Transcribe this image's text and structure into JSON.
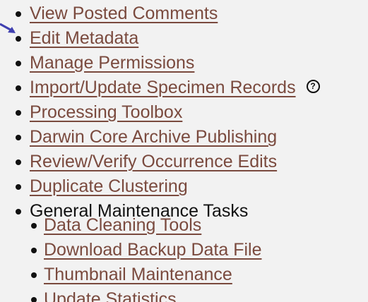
{
  "menu": {
    "items": [
      {
        "label": "View Posted Comments"
      },
      {
        "label": "Edit Metadata"
      },
      {
        "label": "Manage Permissions"
      },
      {
        "label": "Import/Update Specimen Records"
      },
      {
        "label": "Processing Toolbox"
      },
      {
        "label": "Darwin Core Archive Publishing"
      },
      {
        "label": "Review/Verify Occurrence Edits"
      },
      {
        "label": "Duplicate Clustering"
      },
      {
        "label": "General Maintenance Tasks"
      }
    ],
    "help_icon": "?"
  },
  "submenu": {
    "items": [
      {
        "label": "Data Cleaning Tools"
      },
      {
        "label": "Download Backup Data File"
      },
      {
        "label": "Thumbnail Maintenance"
      },
      {
        "label": "Update Statistics"
      }
    ]
  },
  "colors": {
    "link": "#7a4a3e",
    "text": "#111111",
    "arrow": "#3f3fb0",
    "background": "#f2f2f2"
  },
  "icons": {
    "help": "help-circle-icon",
    "arrow": "arrow-icon"
  }
}
